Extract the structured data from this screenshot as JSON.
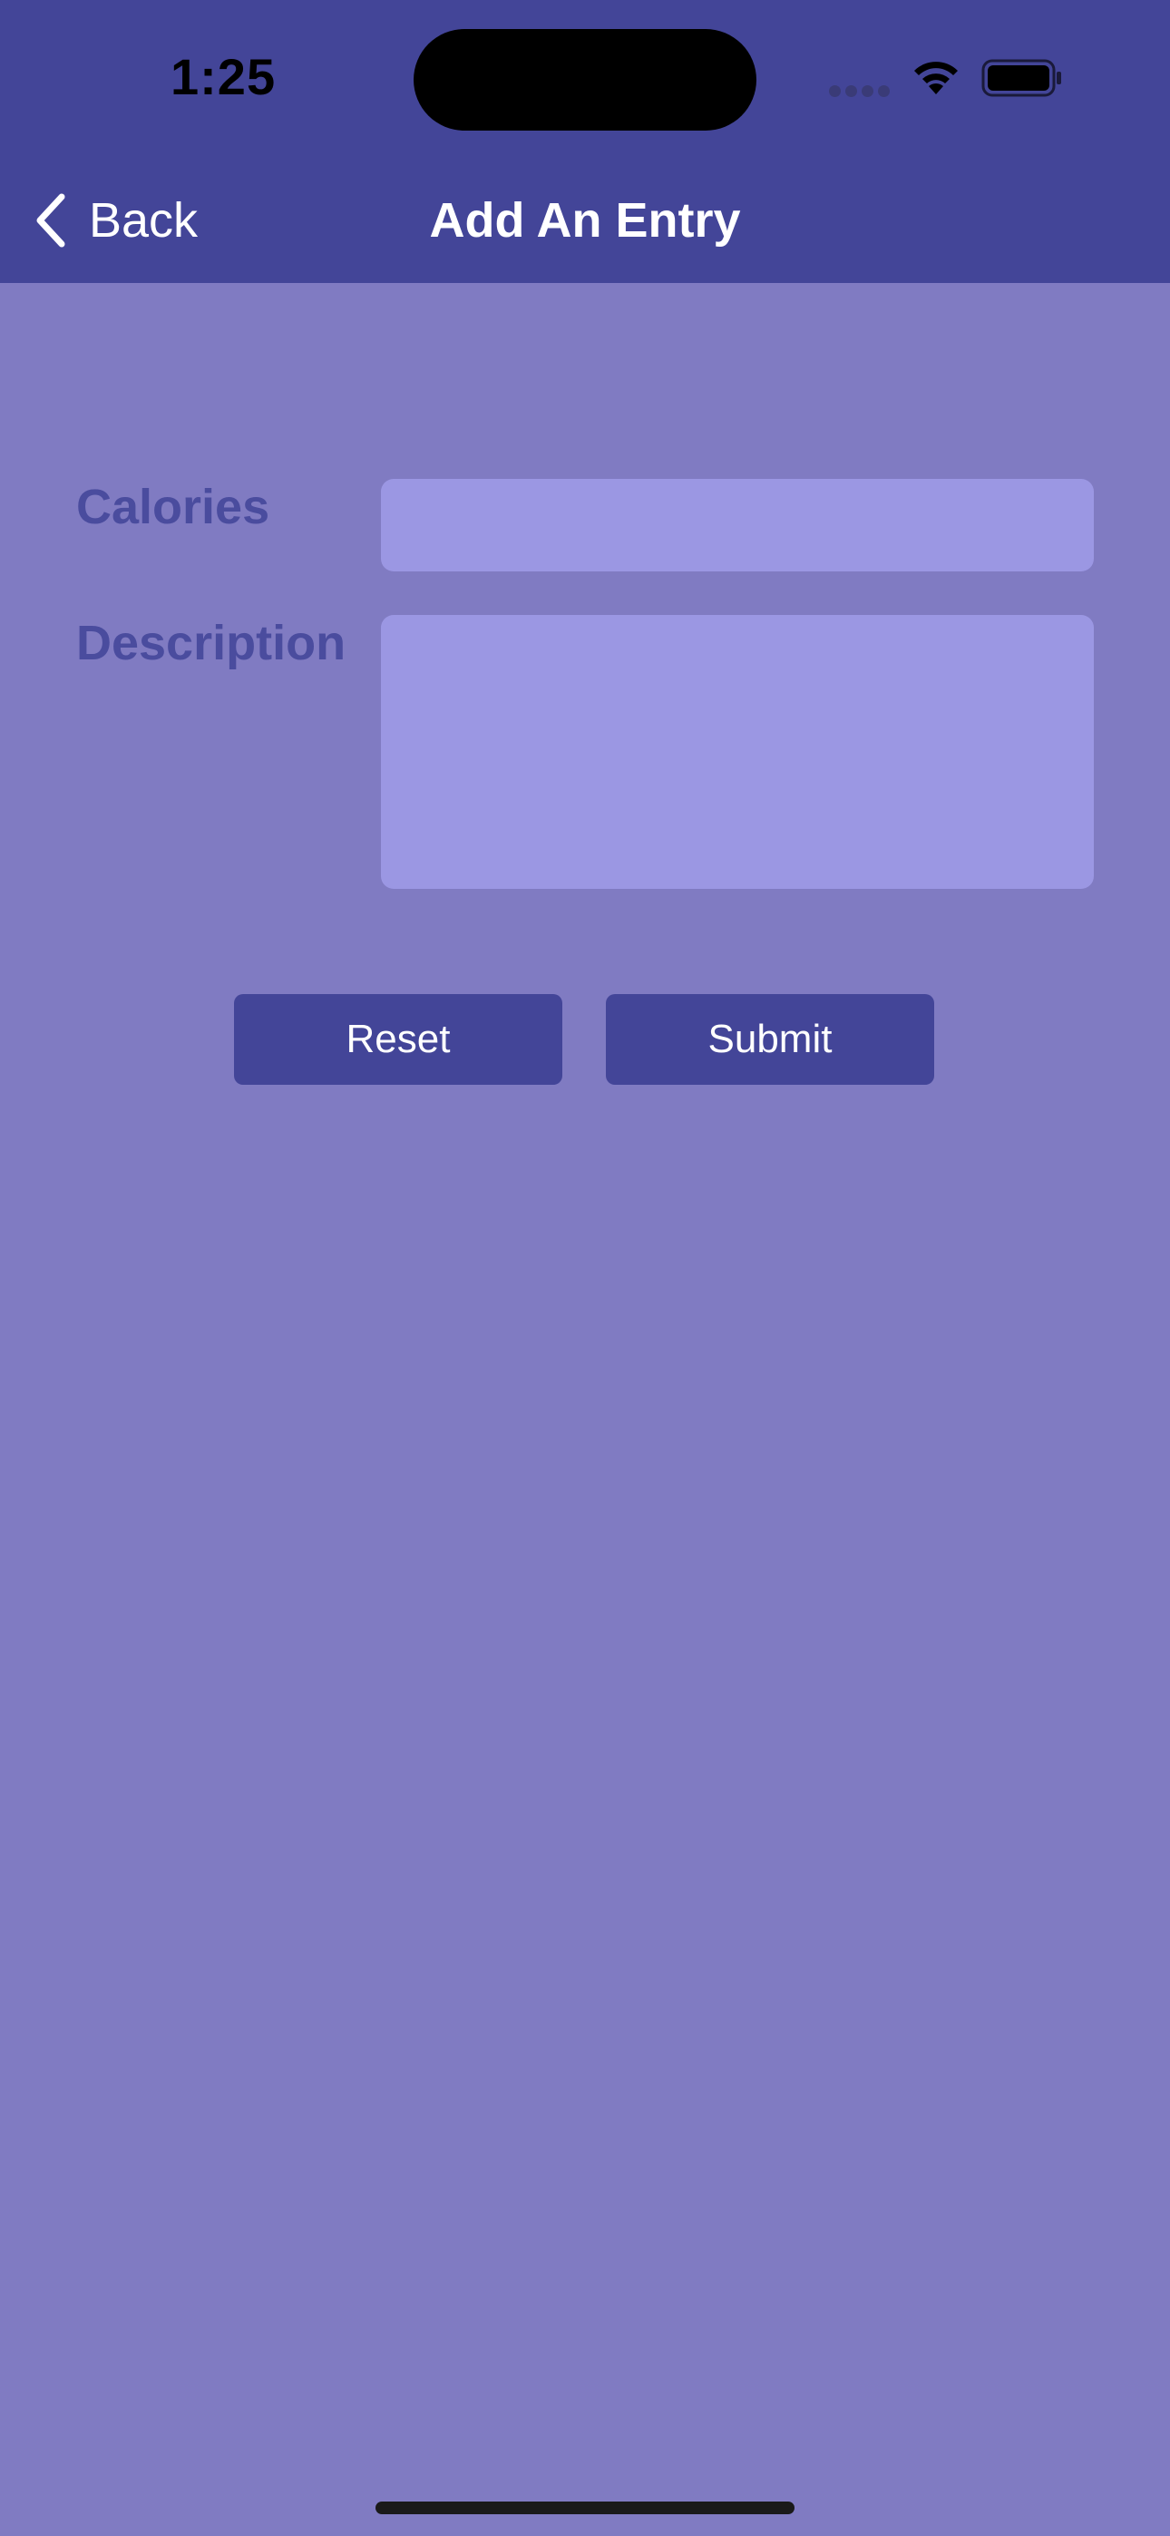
{
  "status_bar": {
    "time": "1:25",
    "icons": [
      "cellular-signal-icon",
      "wifi-icon",
      "battery-icon"
    ]
  },
  "nav": {
    "back_label": "Back",
    "title": "Add An Entry"
  },
  "form": {
    "calories_label": "Calories",
    "calories_value": "",
    "description_label": "Description",
    "description_value": ""
  },
  "buttons": {
    "reset_label": "Reset",
    "submit_label": "Submit"
  },
  "colors": {
    "header_bg": "#434598",
    "page_bg": "#807bc2",
    "field_bg": "#9b97e3",
    "label_color": "#4a4c9e",
    "button_bg": "#434598"
  }
}
